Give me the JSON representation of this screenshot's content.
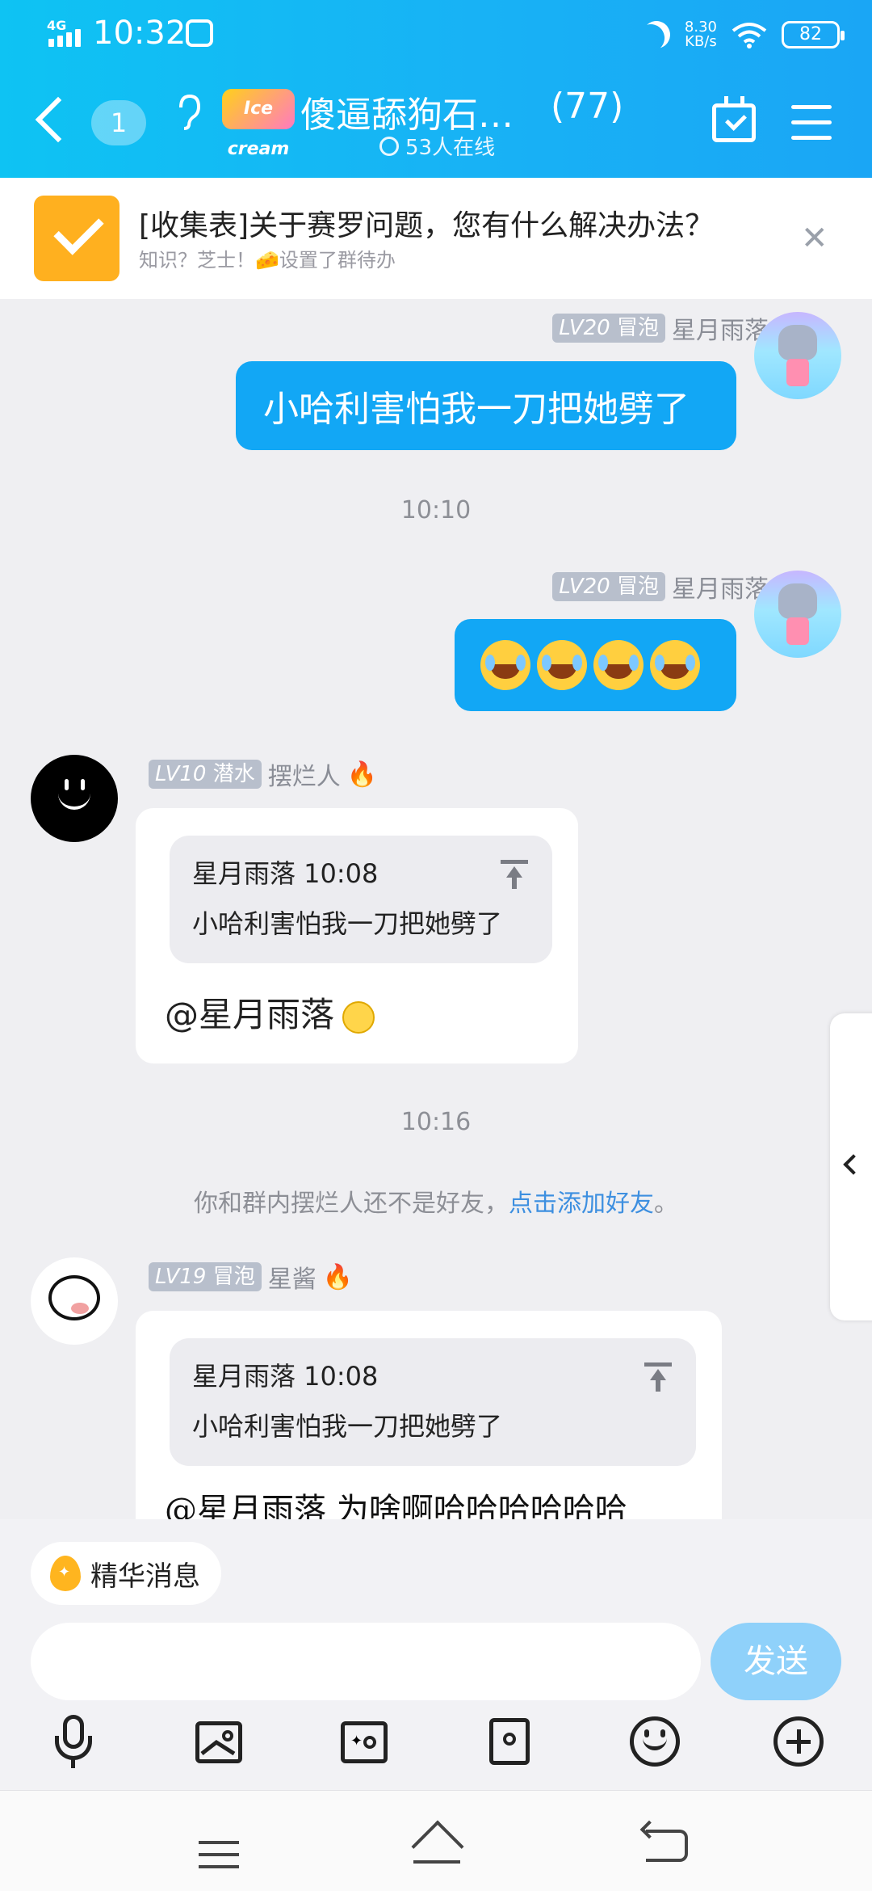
{
  "status_bar": {
    "time": "10:32",
    "network": "4G",
    "speed_value": "8.30",
    "speed_unit": "KB/s",
    "battery": "82"
  },
  "header": {
    "unread_count": "1",
    "group_logo_text": "Ice cream",
    "group_title": "傻逼舔狗石…",
    "member_count": "(77)",
    "online_text": "53人在线"
  },
  "pinned": {
    "title": "[收集表]关于赛罗问题，您有什么解决办法？",
    "subtitle": "知识？芝士！🧀设置了群待办"
  },
  "messages": [
    {
      "level": "LV20",
      "rank": "冒泡",
      "sender": "星月雨落",
      "text": "小哈利害怕我一刀把她劈了"
    },
    {
      "timestamp": "10:10"
    },
    {
      "level": "LV20",
      "rank": "冒泡",
      "sender": "星月雨落",
      "emoji_alt": "😂😂😂😂"
    },
    {
      "level": "LV10",
      "rank": "潜水",
      "sender": "摆烂人",
      "quote_name": "星月雨落 10:08",
      "quote_text": "小哈利害怕我一刀把她劈了",
      "text": "@星月雨落"
    },
    {
      "timestamp": "10:16"
    },
    {
      "sys_prefix": "你和群内摆烂人还不是好友，",
      "sys_link": "点击添加好友",
      "sys_suffix": "。"
    },
    {
      "level": "LV19",
      "rank": "冒泡",
      "sender": "星酱",
      "quote_name": "星月雨落 10:08",
      "quote_text": "小哈利害怕我一刀把她劈了",
      "text": "@星月雨落 为啥啊哈哈哈哈哈哈"
    }
  ],
  "composer": {
    "essence_label": "精华消息",
    "input_value": "",
    "send_label": "发送"
  },
  "colors": {
    "header": "#18b2f5",
    "bubble_blue": "#12a7f5",
    "send_button": "#8fd1fa",
    "pin_icon": "#ffb01f"
  }
}
